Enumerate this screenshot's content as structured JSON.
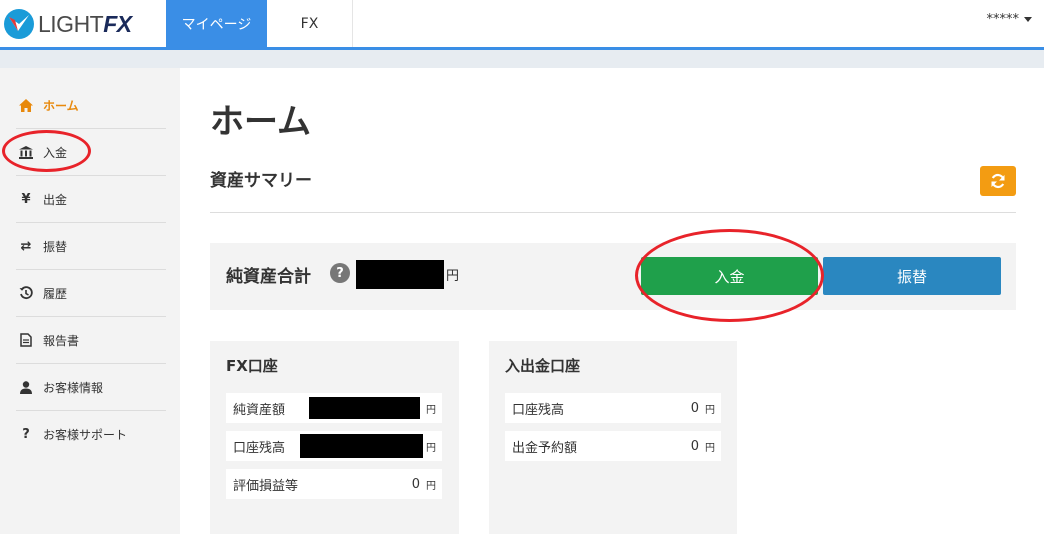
{
  "header": {
    "logo_text_light": "LIGHT",
    "logo_text_fx": "FX",
    "tabs": [
      {
        "label": "マイページ",
        "active": true
      },
      {
        "label": "FX",
        "active": false
      }
    ],
    "user_name": "*****",
    "accent_color": "#3a8ee6"
  },
  "sidebar": {
    "items": [
      {
        "label": "ホーム",
        "icon": "home-icon",
        "active": true
      },
      {
        "label": "入金",
        "icon": "bank-icon",
        "active": false
      },
      {
        "label": "出金",
        "icon": "yen-icon",
        "active": false
      },
      {
        "label": "振替",
        "icon": "exchange-icon",
        "active": false
      },
      {
        "label": "履歴",
        "icon": "history-icon",
        "active": false
      },
      {
        "label": "報告書",
        "icon": "document-icon",
        "active": false
      },
      {
        "label": "お客様情報",
        "icon": "user-icon",
        "active": false
      },
      {
        "label": "お客様サポート",
        "icon": "question-icon",
        "active": false
      }
    ]
  },
  "main": {
    "page_title": "ホーム",
    "section_title": "資産サマリー",
    "net_assets_label": "純資産合計",
    "net_assets_unit": "円",
    "deposit_button": "入金",
    "transfer_button": "振替",
    "fx_account": {
      "title": "FX口座",
      "rows": [
        {
          "label": "純資産額",
          "value": "",
          "unit": "円",
          "redacted": true
        },
        {
          "label": "口座残高",
          "value": "",
          "unit": "円",
          "redacted": true
        },
        {
          "label": "評価損益等",
          "value": "0",
          "unit": "円",
          "redacted": false
        }
      ]
    },
    "io_account": {
      "title": "入出金口座",
      "rows": [
        {
          "label": "口座残高",
          "value": "0",
          "unit": "円"
        },
        {
          "label": "出金予約額",
          "value": "0",
          "unit": "円"
        }
      ]
    }
  },
  "colors": {
    "deposit": "#1fa04b",
    "transfer": "#2a87c0",
    "refresh": "#f39c12",
    "active_nav": "#e8890c",
    "annotation": "#e8232a"
  }
}
